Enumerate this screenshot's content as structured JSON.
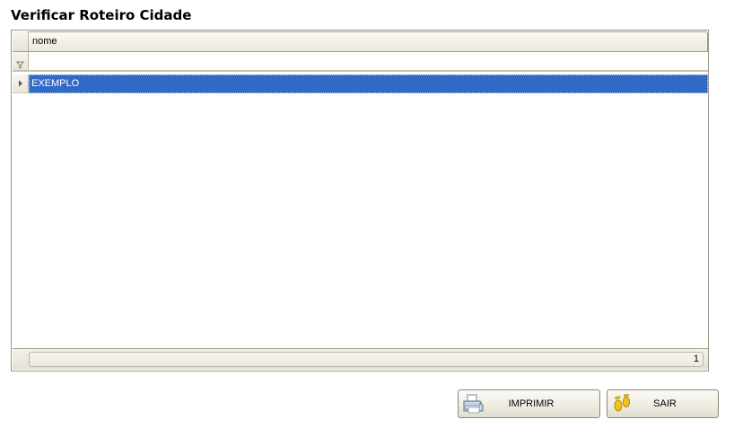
{
  "page": {
    "title": "Verificar Roteiro Cidade"
  },
  "grid": {
    "columns": [
      {
        "label": "nome"
      }
    ],
    "filter_value": "",
    "rows": [
      {
        "nome": "EXEMPLO",
        "selected": true
      }
    ],
    "footer_count": "1"
  },
  "buttons": {
    "print_label": "IMPRIMIR",
    "print_icon": "printer-icon",
    "exit_label": "SAIR",
    "exit_icon": "footprints-icon"
  },
  "colors": {
    "selection": "#316ac5",
    "header_border": "#a49c85"
  }
}
